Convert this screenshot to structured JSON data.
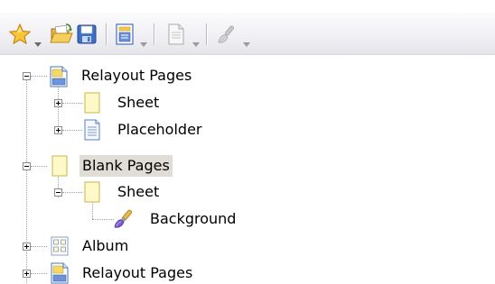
{
  "toolbar": {
    "buttons": [
      {
        "name": "favorites",
        "icon": "star-icon",
        "has_dropdown": true
      },
      {
        "name": "open",
        "icon": "open-folder-icon",
        "has_dropdown": false
      },
      {
        "name": "save",
        "icon": "save-disk-icon",
        "has_dropdown": false
      },
      {
        "name": "page-layout",
        "icon": "page-layout-icon",
        "has_dropdown": true
      },
      {
        "name": "page",
        "icon": "page-icon",
        "has_dropdown": true
      },
      {
        "name": "background",
        "icon": "paint-brush-icon",
        "has_dropdown": true
      }
    ]
  },
  "tree": {
    "nodes": [
      {
        "label": "Relayout Pages",
        "icon": "relayout-page-icon",
        "level": 0,
        "expander": "minus",
        "selected": false
      },
      {
        "label": "Sheet",
        "icon": "sheet-icon",
        "level": 1,
        "expander": "plus",
        "selected": false
      },
      {
        "label": "Placeholder",
        "icon": "placeholder-page-icon",
        "level": 1,
        "expander": "plus",
        "selected": false
      },
      {
        "label": "Blank Pages",
        "icon": "blank-page-icon",
        "level": 0,
        "expander": "minus",
        "selected": true
      },
      {
        "label": "Sheet",
        "icon": "sheet-icon",
        "level": 1,
        "expander": "minus",
        "selected": false
      },
      {
        "label": "Background",
        "icon": "paint-brush-icon",
        "level": 2,
        "expander": "none",
        "selected": false
      },
      {
        "label": "Album",
        "icon": "album-grid-icon",
        "level": 0,
        "expander": "plus",
        "selected": false
      },
      {
        "label": "Relayout Pages",
        "icon": "relayout-page-icon",
        "level": 0,
        "expander": "plus",
        "selected": false
      }
    ]
  },
  "colors": {
    "selection_bg": "#dfddd6",
    "sheet_fill": "#fff8c8",
    "page_blue": "#5a86c8",
    "toolbar_bg": "#f1f1f5"
  }
}
